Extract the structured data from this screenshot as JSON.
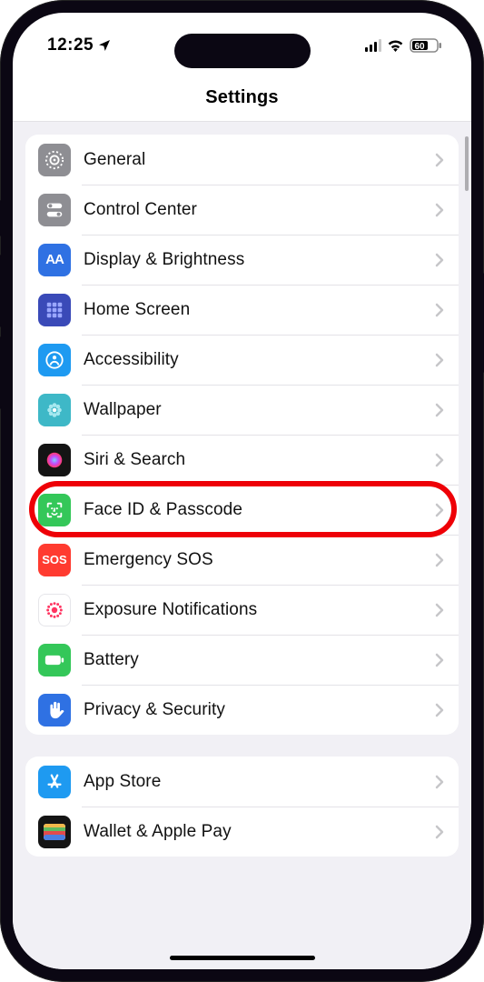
{
  "status": {
    "time": "12:25",
    "battery_pct": "60"
  },
  "header": {
    "title": "Settings"
  },
  "group1": [
    {
      "label": "General",
      "icon": "gear",
      "bg": "#8e8e93"
    },
    {
      "label": "Control Center",
      "icon": "toggles",
      "bg": "#8e8e93"
    },
    {
      "label": "Display & Brightness",
      "icon": "aa",
      "bg": "#2f71e3"
    },
    {
      "label": "Home Screen",
      "icon": "grid",
      "bg": "#3a4ab8"
    },
    {
      "label": "Accessibility",
      "icon": "person",
      "bg": "#1e9af1"
    },
    {
      "label": "Wallpaper",
      "icon": "flower",
      "bg": "#3eb8c7"
    },
    {
      "label": "Siri & Search",
      "icon": "siri",
      "bg": "#141414"
    },
    {
      "label": "Face ID & Passcode",
      "icon": "faceid",
      "bg": "#34c759",
      "highlighted": true
    },
    {
      "label": "Emergency SOS",
      "icon": "sos",
      "bg": "#ff3b30"
    },
    {
      "label": "Exposure Notifications",
      "icon": "exposure",
      "bg": "#ffffff"
    },
    {
      "label": "Battery",
      "icon": "battery",
      "bg": "#34c759"
    },
    {
      "label": "Privacy & Security",
      "icon": "hand",
      "bg": "#2f71e3"
    }
  ],
  "group2": [
    {
      "label": "App Store",
      "icon": "appstore",
      "bg": "#1e9af1"
    },
    {
      "label": "Wallet & Apple Pay",
      "icon": "wallet",
      "bg": "#141414"
    }
  ]
}
